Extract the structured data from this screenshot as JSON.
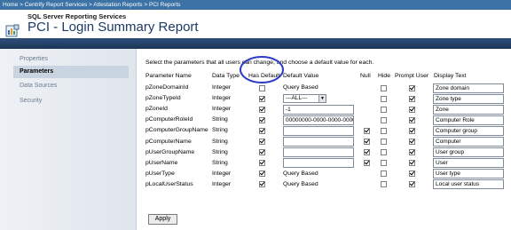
{
  "breadcrumb": [
    "Home",
    "Centrify Report Services",
    "Attestation Reports",
    "PCI Reports"
  ],
  "breadcrumb_separator": ">",
  "header": {
    "service_name": "SQL Server Reporting Services",
    "title": "PCI - Login Summary Report",
    "icon": "report-icon"
  },
  "sidebar": {
    "items": [
      {
        "label": "Properties",
        "active": false
      },
      {
        "label": "Parameters",
        "active": true
      },
      {
        "label": "Data Sources",
        "active": false
      },
      {
        "label": "Security",
        "active": false
      }
    ]
  },
  "main": {
    "instructions": "Select the parameters that all users can change, and choose a default value for each.",
    "columns": [
      "Parameter Name",
      "Data Type",
      "Has Default",
      "Default Value",
      "Null",
      "Hide",
      "Prompt User",
      "Display Text"
    ],
    "rows": [
      {
        "name": "pZoneDomainId",
        "type": "Integer",
        "has_default": false,
        "default_kind": "text",
        "default": "Query Based",
        "null_show": false,
        "null": false,
        "hide": false,
        "prompt": true,
        "display": "Zone domain"
      },
      {
        "name": "pZoneTypeId",
        "type": "Integer",
        "has_default": true,
        "default_kind": "select",
        "default": "---ALL---",
        "null_show": false,
        "null": false,
        "hide": false,
        "prompt": true,
        "display": "Zone type"
      },
      {
        "name": "pZoneId",
        "type": "Integer",
        "has_default": true,
        "default_kind": "input",
        "default": "-1",
        "null_show": false,
        "null": false,
        "hide": false,
        "prompt": true,
        "display": "Zone"
      },
      {
        "name": "pComputerRoleId",
        "type": "String",
        "has_default": true,
        "default_kind": "input",
        "default": "00000000-0000-0000-0000",
        "null_show": false,
        "null": false,
        "hide": false,
        "prompt": true,
        "display": "Computer Role"
      },
      {
        "name": "pComputerGroupName",
        "type": "String",
        "has_default": true,
        "default_kind": "input",
        "default": "",
        "null_show": true,
        "null": true,
        "hide": false,
        "prompt": true,
        "display": "Computer group"
      },
      {
        "name": "pComputerName",
        "type": "String",
        "has_default": true,
        "default_kind": "input",
        "default": "",
        "null_show": true,
        "null": true,
        "hide": false,
        "prompt": true,
        "display": "Computer"
      },
      {
        "name": "pUserGroupName",
        "type": "String",
        "has_default": true,
        "default_kind": "input",
        "default": "",
        "null_show": true,
        "null": true,
        "hide": false,
        "prompt": true,
        "display": "User group"
      },
      {
        "name": "pUserName",
        "type": "String",
        "has_default": true,
        "default_kind": "input",
        "default": "",
        "null_show": true,
        "null": true,
        "hide": false,
        "prompt": true,
        "display": "User"
      },
      {
        "name": "pUserType",
        "type": "Integer",
        "has_default": true,
        "default_kind": "text",
        "default": "Query Based",
        "null_show": false,
        "null": false,
        "hide": false,
        "prompt": true,
        "display": "User type"
      },
      {
        "name": "pLocalUserStatus",
        "type": "Integer",
        "has_default": true,
        "default_kind": "text",
        "default": "Query Based",
        "null_show": false,
        "null": false,
        "hide": false,
        "prompt": true,
        "display": "Local user status"
      }
    ],
    "apply_label": "Apply"
  },
  "colors": {
    "breadcrumb_bg": "#3d72a4",
    "band": "#2e4f7a",
    "title": "#1c3a66",
    "highlight_ellipse": "#2e3cc4"
  }
}
